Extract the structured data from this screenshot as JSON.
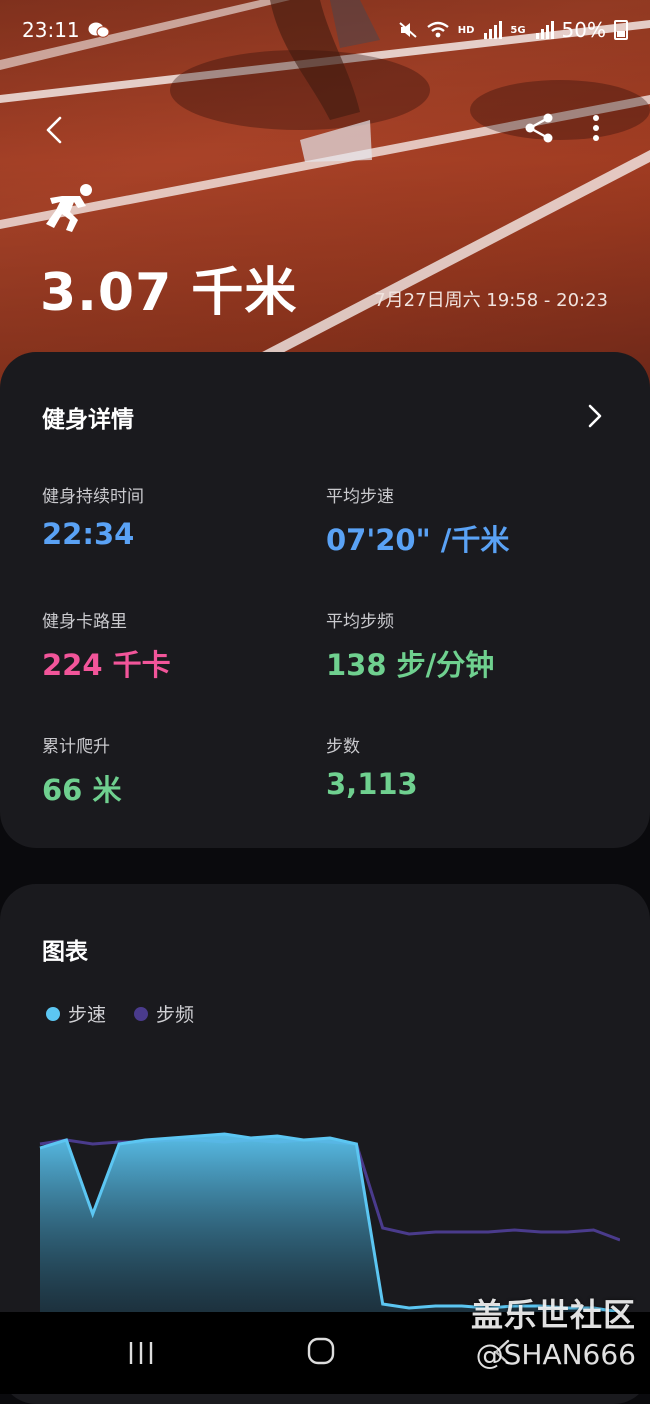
{
  "status_bar": {
    "time": "23:11",
    "battery": "50%",
    "signal_tag": "HD",
    "network_tag": "5G"
  },
  "header": {
    "distance": "3.07 千米",
    "time_range": "7月27日周六 19:58 - 20:23",
    "icons": [
      "back-arrow-icon",
      "share-icon",
      "more-vert-icon",
      "runner-icon"
    ]
  },
  "details": {
    "title": "健身详情",
    "stats": [
      {
        "label": "健身持续时间",
        "value": "22:34",
        "color": "#5aa2f5"
      },
      {
        "label": "平均步速",
        "value": "07'20\" /千米",
        "color": "#5aa2f5"
      },
      {
        "label": "健身卡路里",
        "value": "224 千卡",
        "color": "#f2559a"
      },
      {
        "label": "平均步频",
        "value": "138 步/分钟",
        "color": "#6fd08f"
      },
      {
        "label": "累计爬升",
        "value": "66 米",
        "color": "#6fd08f"
      },
      {
        "label": "步数",
        "value": "3,113",
        "color": "#6fd08f"
      }
    ]
  },
  "chart": {
    "title": "图表",
    "legend": [
      {
        "name": "步速",
        "color": "#5cc6f2"
      },
      {
        "name": "步频",
        "color": "#4a3b8c"
      }
    ]
  },
  "chart_data": {
    "type": "area",
    "x": [
      0,
      1,
      2,
      3,
      4,
      5,
      6,
      7,
      8,
      9,
      10,
      11,
      12,
      13,
      14,
      15,
      16,
      17,
      18,
      19,
      20,
      21,
      22
    ],
    "series": [
      {
        "name": "步速",
        "values": [
          88,
          92,
          55,
          90,
          92,
          93,
          94,
          95,
          93,
          94,
          92,
          93,
          90,
          10,
          8,
          9,
          9,
          8,
          9,
          9,
          8,
          8,
          6
        ]
      },
      {
        "name": "步频",
        "values": [
          90,
          92,
          90,
          91,
          91,
          92,
          92,
          91,
          92,
          91,
          92,
          91,
          90,
          48,
          45,
          46,
          46,
          46,
          47,
          46,
          46,
          47,
          42
        ]
      }
    ],
    "ylim": [
      0,
      100
    ],
    "grid": false
  },
  "watermark": {
    "line1": "盖乐世社区",
    "line2": "@SHAN666"
  }
}
